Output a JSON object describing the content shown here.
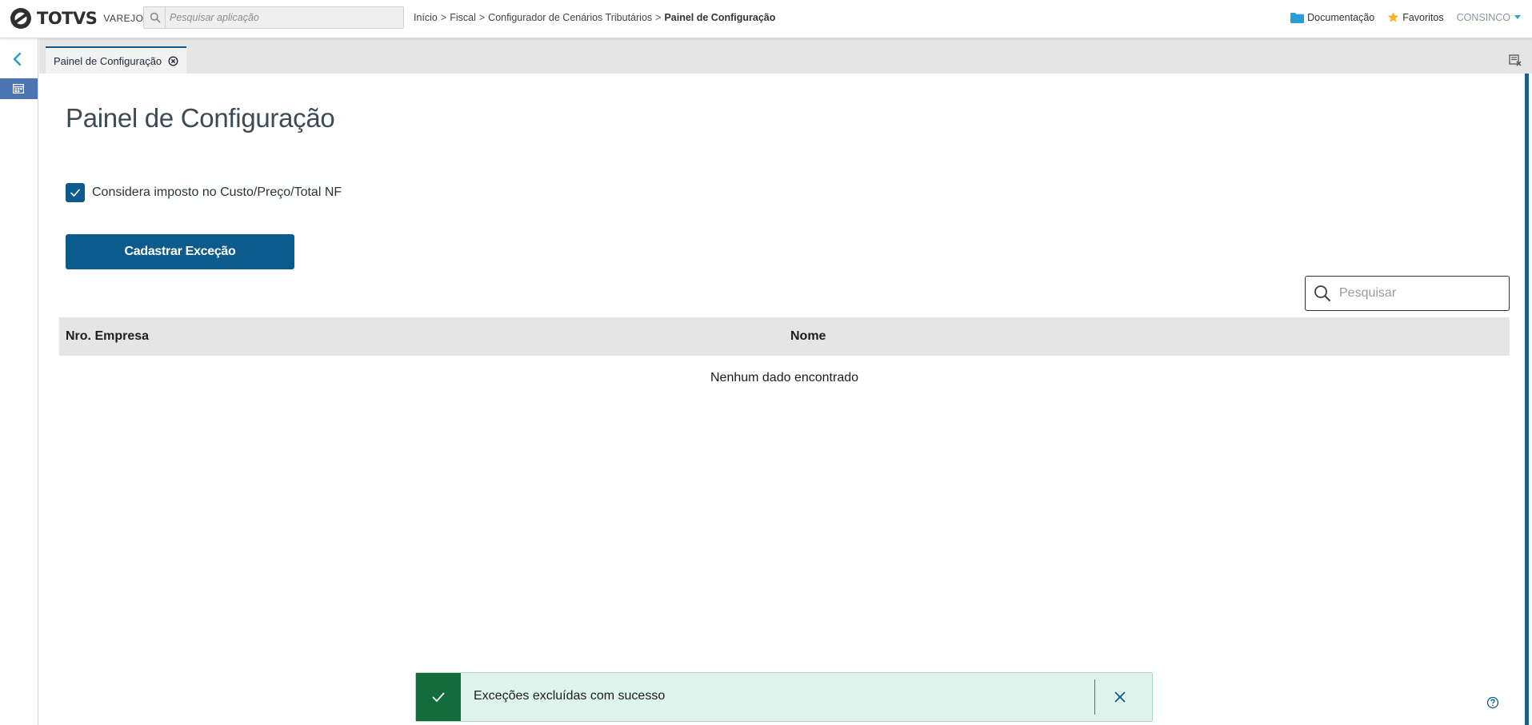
{
  "header": {
    "logo_text": "TOTVS",
    "logo_sub": "VAREJO",
    "search_placeholder": "Pesquisar aplicação",
    "breadcrumb": [
      "Início",
      "Fiscal",
      "Configurador de Cenários Tributários",
      "Painel de Configuração"
    ],
    "breadcrumb_separator": ">",
    "links": {
      "documentation": "Documentação",
      "favorites": "Favoritos"
    },
    "user": "CONSINCO"
  },
  "tabs": [
    {
      "label": "Painel de Configuração"
    }
  ],
  "page": {
    "title": "Painel de Configuração",
    "checkbox": {
      "label": "Considera imposto no Custo/Preço/Total NF",
      "checked": true
    },
    "primary_button": "Cadastrar Exceção",
    "table_search_placeholder": "Pesquisar",
    "table": {
      "columns": [
        "Nro. Empresa",
        "Nome"
      ],
      "rows": [],
      "empty_message": "Nenhum dado encontrado"
    }
  },
  "toast": {
    "type": "success",
    "message": "Exceções excluídas com sucesso"
  },
  "colors": {
    "primary": "#0d5b8d",
    "sidebar_active": "#4c76b3",
    "toast_bg": "#ddf5ec",
    "toast_icon_bg": "#136c3e",
    "favorites_star": "#f5b324",
    "documentation_folder": "#2a9fd6"
  },
  "icons": [
    "totvs-logo-icon",
    "search-icon",
    "folder-icon",
    "star-icon",
    "chevron-left-icon",
    "dashboard-icon",
    "close-circle-icon",
    "clear-tabs-icon",
    "checkmark-icon",
    "close-icon",
    "help-icon"
  ]
}
